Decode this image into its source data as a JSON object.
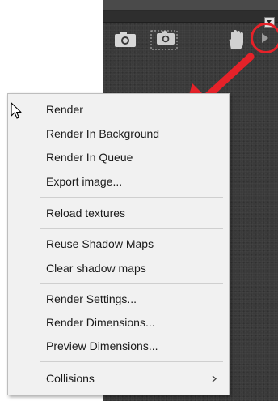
{
  "toolbar": {
    "icons": [
      "camera-icon",
      "camera-region-icon",
      "hand-icon",
      "play-icon"
    ],
    "highlight_color": "#e52229"
  },
  "menu": {
    "items": [
      {
        "label": "Render"
      },
      {
        "label": "Render In Background"
      },
      {
        "label": "Render In Queue"
      },
      {
        "label": "Export image..."
      },
      {
        "label": "Reload textures"
      },
      {
        "label": "Reuse Shadow Maps"
      },
      {
        "label": "Clear shadow maps"
      },
      {
        "label": "Render Settings..."
      },
      {
        "label": "Render Dimensions..."
      },
      {
        "label": "Preview Dimensions..."
      },
      {
        "label": "Collisions",
        "submenu": true
      }
    ]
  }
}
